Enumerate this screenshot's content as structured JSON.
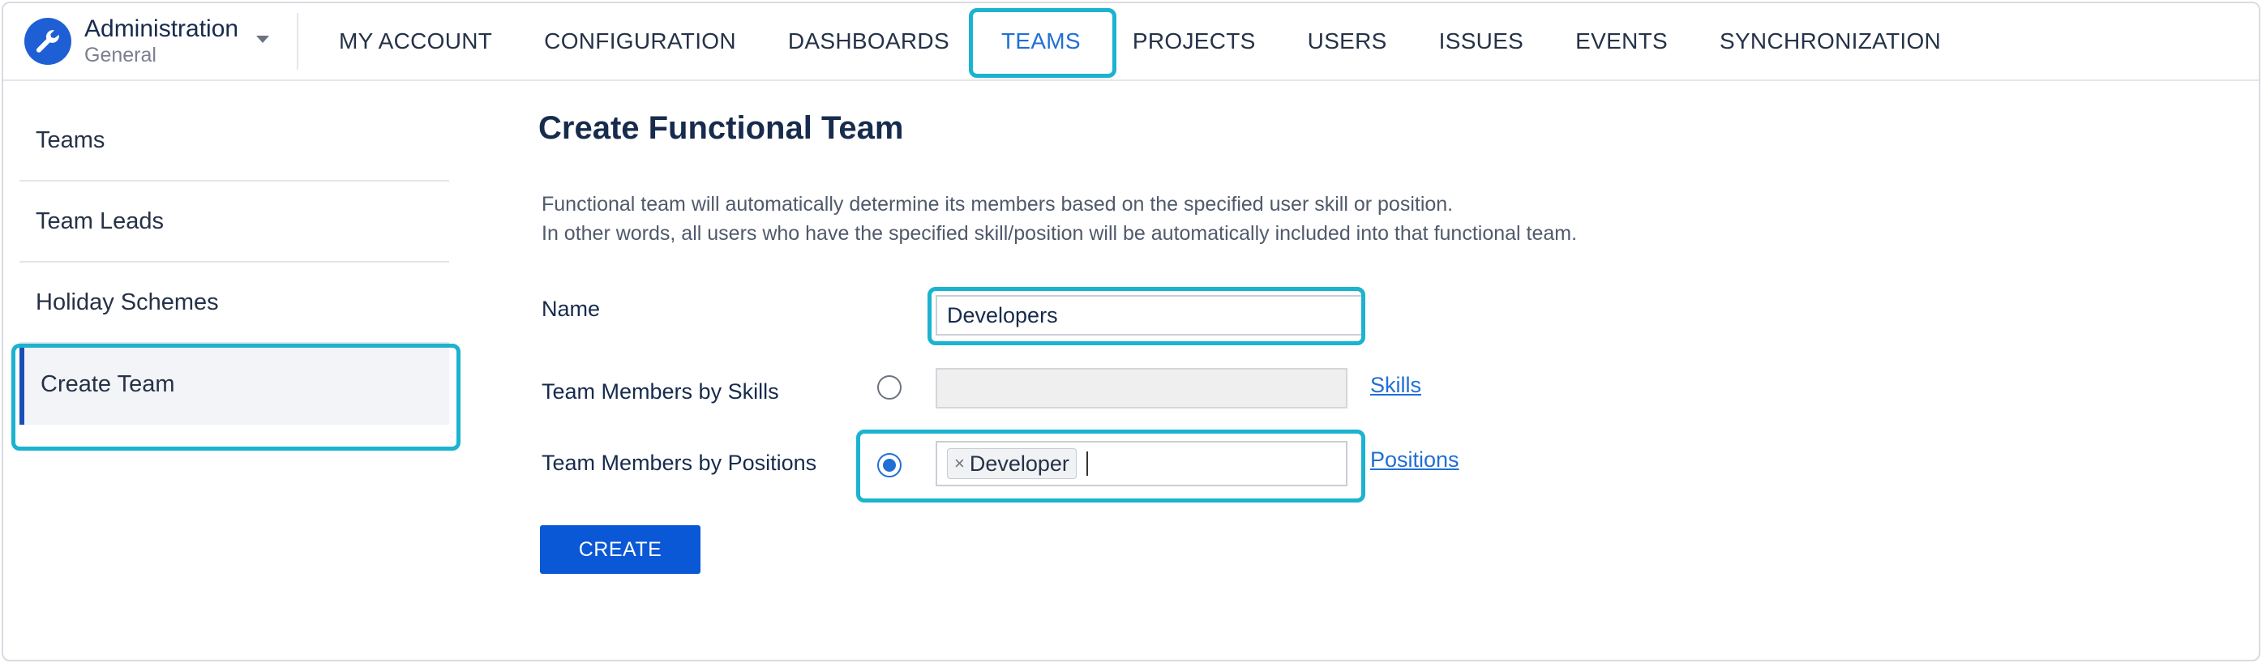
{
  "header": {
    "brand_title": "Administration",
    "brand_subtitle": "General",
    "nav": [
      "MY ACCOUNT",
      "CONFIGURATION",
      "DASHBOARDS",
      "TEAMS",
      "PROJECTS",
      "USERS",
      "ISSUES",
      "EVENTS",
      "SYNCHRONIZATION"
    ],
    "active_nav": "TEAMS"
  },
  "sidebar": {
    "items": [
      {
        "label": "Teams"
      },
      {
        "label": "Team Leads"
      },
      {
        "label": "Holiday Schemes"
      },
      {
        "label": "Create Team"
      }
    ],
    "active": "Create Team"
  },
  "main": {
    "title": "Create Functional Team",
    "description_line1": "Functional team will automatically determine its members based on the specified user skill or position.",
    "description_line2": "In other words, all users who have the specified skill/position will be automatically included into that functional team.",
    "name_label": "Name",
    "name_value": "Developers",
    "skills_label": "Team Members by Skills",
    "skills_link": "Skills",
    "skills_selected": false,
    "positions_label": "Team Members by Positions",
    "positions_link": "Positions",
    "positions_selected": true,
    "positions_chips": [
      "Developer"
    ],
    "chip_remove": "×",
    "create_button": "CREATE"
  },
  "colors": {
    "accent": "#1f6fd6",
    "highlight": "#1bb3cf",
    "button": "#0a58d6",
    "brand_icon_bg": "#1f5fd6"
  },
  "icons": {
    "brand": "wrench-icon",
    "dropdown": "caret-down-icon"
  }
}
